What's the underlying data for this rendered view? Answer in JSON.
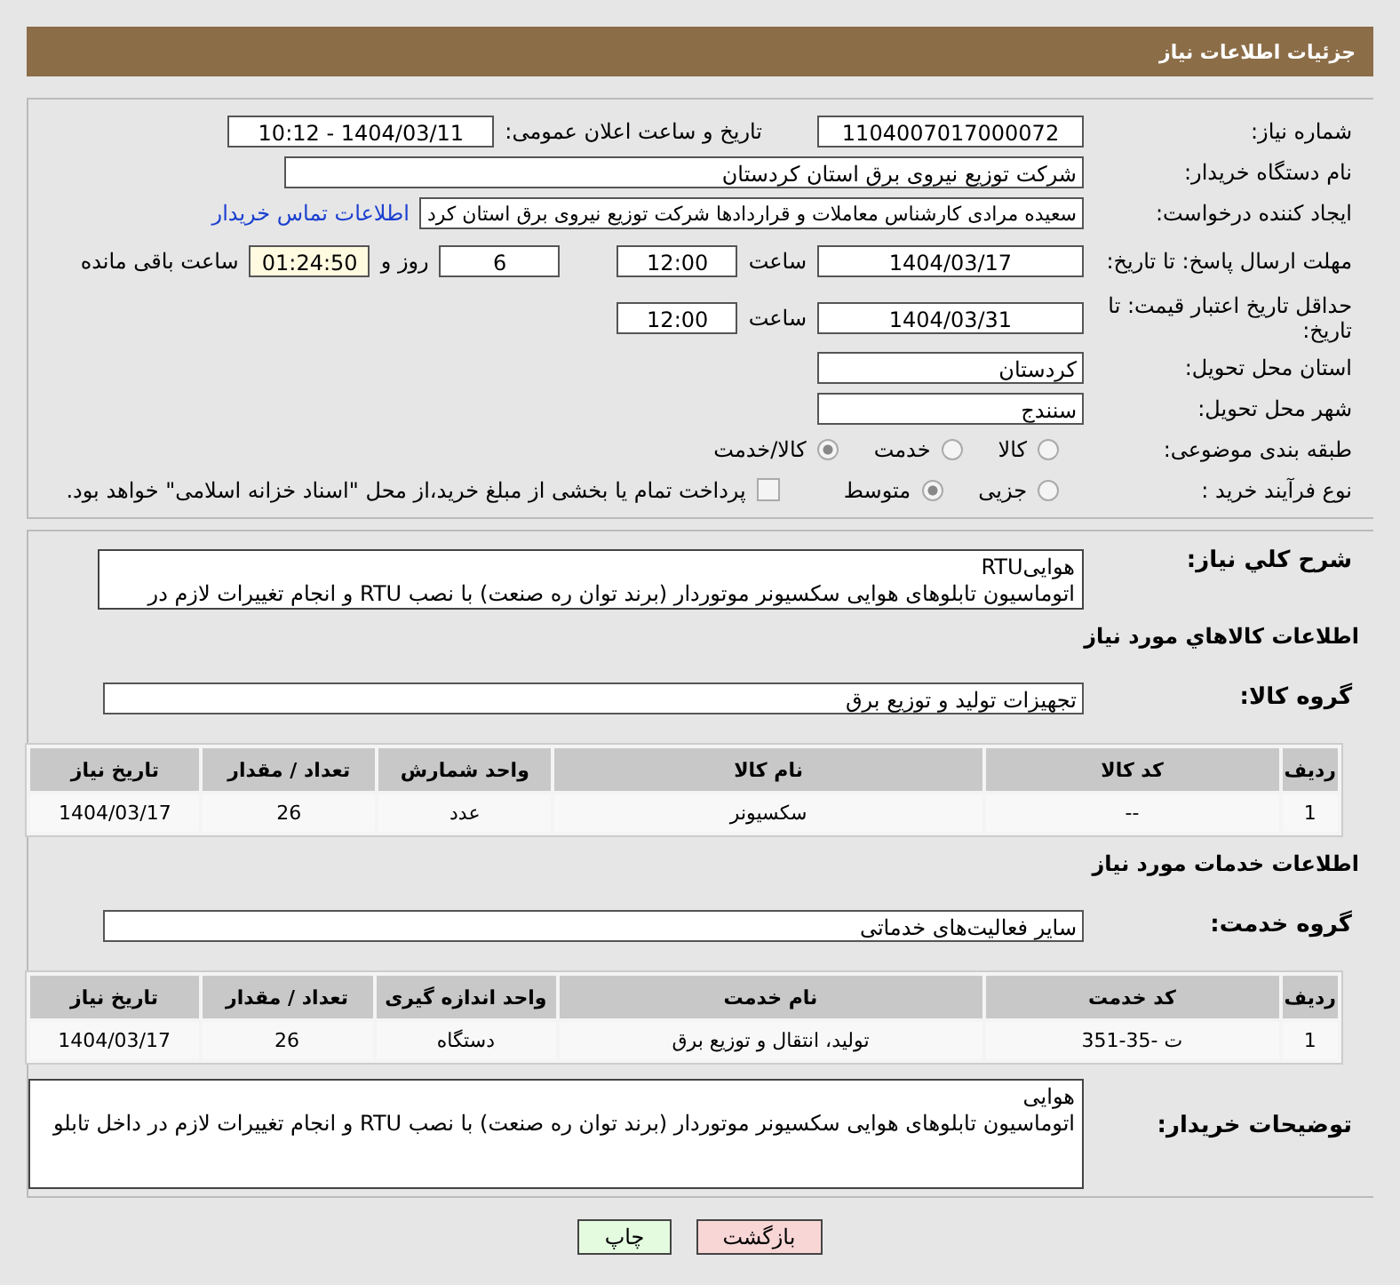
{
  "header": {
    "title": "جزئیات اطلاعات نیاز"
  },
  "details": {
    "need_number": {
      "label": "شماره نیاز:",
      "value": "1104007017000072"
    },
    "announce": {
      "label": "تاریخ و ساعت اعلان عمومی:",
      "value": "1404/03/11 - 10:12"
    },
    "buyer": {
      "label": "نام دستگاه خریدار:",
      "value": "شرکت توزیع نیروی برق استان کردستان"
    },
    "creator": {
      "label": "ایجاد کننده درخواست:",
      "value": "سعیده مرادی کارشناس معاملات و قراردادها شرکت توزیع نیروی برق استان کرد",
      "link": "اطلاعات تماس خریدار"
    },
    "deadline": {
      "label": "مهلت ارسال پاسخ: تا تاریخ:",
      "date": "1404/03/17",
      "time_label": "ساعت",
      "time": "12:00",
      "days": "6",
      "days_label": "روز و",
      "remaining": "01:24:50",
      "remaining_label": "ساعت باقی مانده"
    },
    "validity": {
      "label": "حداقل تاریخ اعتبار قیمت: تا تاریخ:",
      "date": "1404/03/31",
      "time_label": "ساعت",
      "time": "12:00"
    },
    "province": {
      "label": "استان محل تحویل:",
      "value": "کردستان"
    },
    "city": {
      "label": "شهر محل تحویل:",
      "value": "سنندج"
    },
    "category": {
      "label": "طبقه بندی موضوعی:",
      "options": [
        {
          "label": "کالا",
          "selected": false
        },
        {
          "label": "خدمت",
          "selected": false
        },
        {
          "label": "کالا/خدمت",
          "selected": true
        }
      ]
    },
    "process": {
      "label": "نوع فرآیند خرید :",
      "options": [
        {
          "label": "جزیی",
          "selected": false
        },
        {
          "label": "متوسط",
          "selected": true
        }
      ],
      "treasury": {
        "checked": false,
        "text": "پرداخت تمام یا بخشی از مبلغ خرید،از محل \"اسناد خزانه اسلامی\" خواهد بود."
      }
    }
  },
  "summary": {
    "label": "شرح كلي نياز:",
    "text": "هواییRTU\nاتوماسیون تابلوهای هوایی سکسیونر موتوردار (برند توان ره صنعت) با نصب RTU و انجام تغییرات لازم در"
  },
  "goods": {
    "title": "اطلاعات كالاهاي مورد نياز",
    "group_label": "گروه كالا:",
    "group": "تجهیزات تولید و توزیع برق",
    "table": {
      "columns": [
        "رديف",
        "کد کالا",
        "نام کالا",
        "واحد شمارش",
        "تعداد / مقدار",
        "تاریخ نیاز"
      ],
      "rows": [
        [
          "1",
          "--",
          "سکسیونر",
          "عدد",
          "26",
          "1404/03/17"
        ]
      ]
    }
  },
  "services": {
    "title": "اطلاعات خدمات مورد نياز",
    "group_label": "گروه خدمت:",
    "group": "سایر فعالیت‌های خدماتی",
    "table": {
      "columns": [
        "رديف",
        "کد خدمت",
        "نام خدمت",
        "واحد اندازه گیری",
        "تعداد / مقدار",
        "تاریخ نیاز"
      ],
      "rows": [
        [
          "1",
          "ت -35-351",
          "تولید، انتقال و توزیع برق",
          "دستگاه",
          "26",
          "1404/03/17"
        ]
      ]
    }
  },
  "buyer_notes": {
    "label": "توضیحات خریدار:",
    "text": "هوایی\nاتوماسیون تابلوهای هوایی سکسیونر موتوردار (برند توان ره صنعت) با نصب RTU و انجام تغییرات لازم در داخل تابلو"
  },
  "buttons": [
    {
      "label": "بازگشت",
      "kind": "back"
    },
    {
      "label": "چاپ",
      "kind": "print"
    }
  ]
}
